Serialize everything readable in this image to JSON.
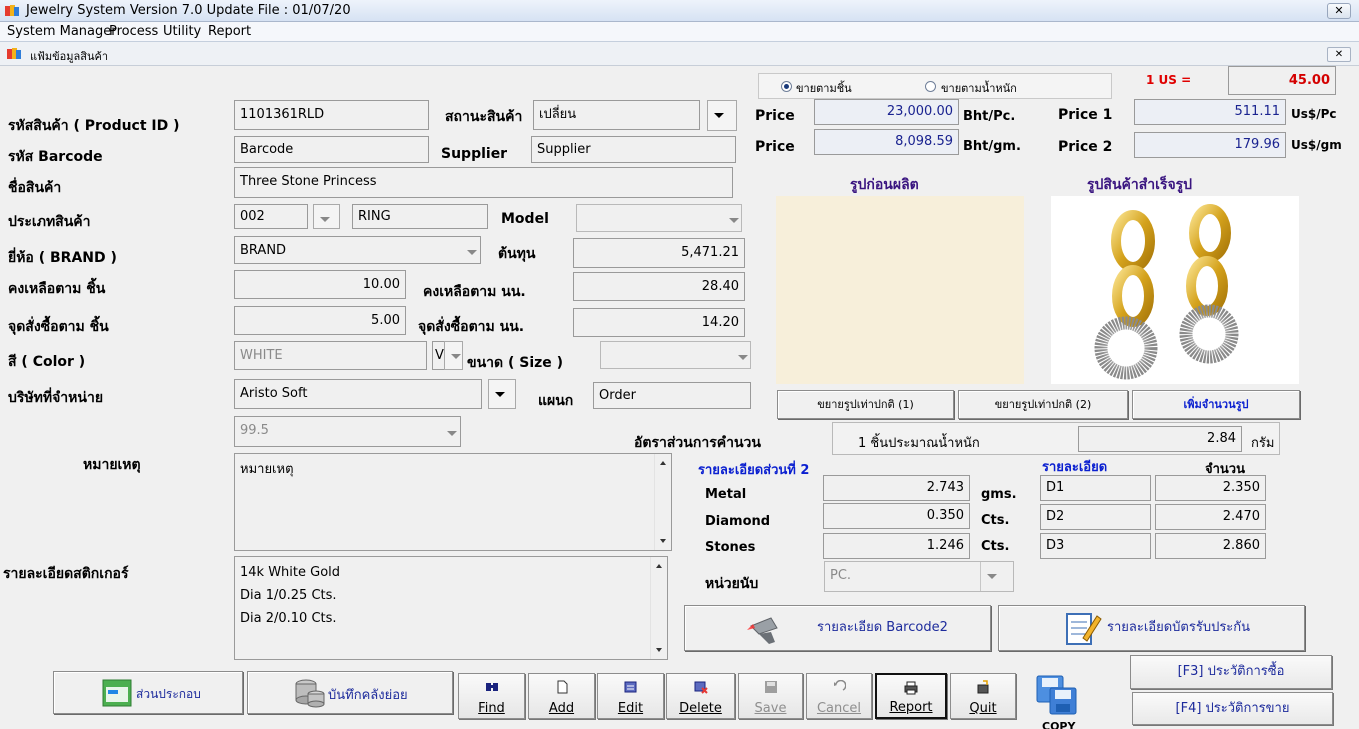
{
  "window": {
    "title": "Jewelry System Version 7.0 Update File : 01/07/20",
    "close": "✕"
  },
  "menu": [
    "System Manager",
    "Process",
    "Utility",
    "Report"
  ],
  "child_window": {
    "title": "แฟ้มข้อมูลสินค้า",
    "close": "✕"
  },
  "sale_mode": {
    "by_piece": "ขายตามชิ้น",
    "by_weight": "ขายตามน้ำหนัก",
    "selected": "by_piece"
  },
  "rate": {
    "label": "1 US =",
    "value": "45.00"
  },
  "labels": {
    "product_id": "รหัสสินค้า ( Product ID )",
    "status": "สถานะสินค้า",
    "barcode": "รหัส Barcode",
    "supplier": "Supplier",
    "name": "ชื่อสินค้า",
    "category": "ประเภทสินค้า",
    "model": "Model",
    "brand": "ยี่ห้อ ( BRAND )",
    "cost": "ต้นทุน",
    "stock_pcs": "คงเหลือตาม ชิ้น",
    "stock_weight": "คงเหลือตาม นน.",
    "reorder_pcs": "จุดสั่งซื้อตาม ชิ้น",
    "reorder_weight": "จุดสั่งซื้อตาม นน.",
    "color": "สี ( Color )",
    "size": "ขนาด ( Size )",
    "company": "บริษัทที่จำหน่าย",
    "dept": "แผนก",
    "calc_ratio": "อัตราส่วนการคำนวน",
    "remark": "หมายเหตุ",
    "sticker": "รายละเอียดสติกเกอร์",
    "price": "Price",
    "price1": "Price 1",
    "price2": "Price 2",
    "unit_bht_pc": "Bht/Pc.",
    "unit_bht_gm": "Bht/gm.",
    "unit_us_pc": "Us$/Pc",
    "unit_us_gm": "Us$/gm",
    "img_before": "รูปก่อนผลิต",
    "img_after": "รูปสินค้าสำเร็จรูป",
    "per_piece": "1 ชิ้นประมาณน้ำหนัก",
    "gram": "กรัม",
    "detail2": "รายละเอียดส่วนที่ 2",
    "detail": "รายละเอียด",
    "qty": "จำนวน",
    "metal": "Metal",
    "diamond": "Diamond",
    "stones": "Stones",
    "gms": "gms.",
    "cts": "Cts.",
    "unit": "หน่วยนับ"
  },
  "values": {
    "product_id": "1101361RLD",
    "status": "เปลี่ยน",
    "barcode": "Barcode",
    "supplier": "Supplier",
    "name": "Three Stone Princess",
    "category_code": "002",
    "category_name": "RING",
    "model": "",
    "brand": "BRAND",
    "cost": "5,471.21",
    "stock_pcs": "10.00",
    "stock_weight": "28.40",
    "reorder_pcs": "5.00",
    "reorder_weight": "14.20",
    "color": "WHITE",
    "color_code": "V",
    "size": "",
    "company": "Aristo Soft",
    "dept": "Order",
    "calc_ratio": "99.5",
    "remark": "หมายเหตุ",
    "sticker_lines": [
      "14k White Gold",
      "Dia 1/0.25 Cts.",
      "Dia 2/0.10 Cts."
    ],
    "price_pc": "23,000.00",
    "price_gm": "8,098.59",
    "price1": "511.11",
    "price2": "179.96",
    "per_piece_weight": "2.84",
    "metal": "2.743",
    "diamond": "0.350",
    "stones": "1.246",
    "unit": "PC.",
    "details": [
      {
        "code": "D1",
        "qty": "2.350"
      },
      {
        "code": "D2",
        "qty": "2.470"
      },
      {
        "code": "D3",
        "qty": "2.860"
      }
    ]
  },
  "buttons": {
    "zoom1": "ขยายรูปเท่าปกติ (1)",
    "zoom2": "ขยายรูปเท่าปกติ (2)",
    "add_images": "เพิ่มจำนวนรูป",
    "barcode2": "รายละเอียด Barcode2",
    "warranty": "รายละเอียดบัตรรับประกัน",
    "components": "ส่วนประกอบ",
    "sub_stock": "บันทึกคลังย่อย",
    "find": "Find",
    "add": "Add",
    "edit": "Edit",
    "delete": "Delete",
    "save": "Save",
    "cancel": "Cancel",
    "report": "Report",
    "quit": "Quit",
    "copy": "COPY",
    "purchase_history": "[F3] ประวัติการซื้อ",
    "sales_history": "[F4] ประวัติการขาย"
  },
  "icons": [
    "app-logo-icon",
    "window-close-icon",
    "radio-icon",
    "dropdown-arrow-icon",
    "barcode-scanner-icon",
    "notepad-icon",
    "find-icon",
    "add-icon",
    "edit-icon",
    "delete-icon",
    "save-icon",
    "cancel-icon",
    "printer-icon",
    "quit-icon",
    "copy-icon",
    "database-icon",
    "form-icon"
  ],
  "colors": {
    "accent_blue": "#1d2b9c",
    "label_red": "#e00000",
    "image_bg": "#f7efda"
  }
}
